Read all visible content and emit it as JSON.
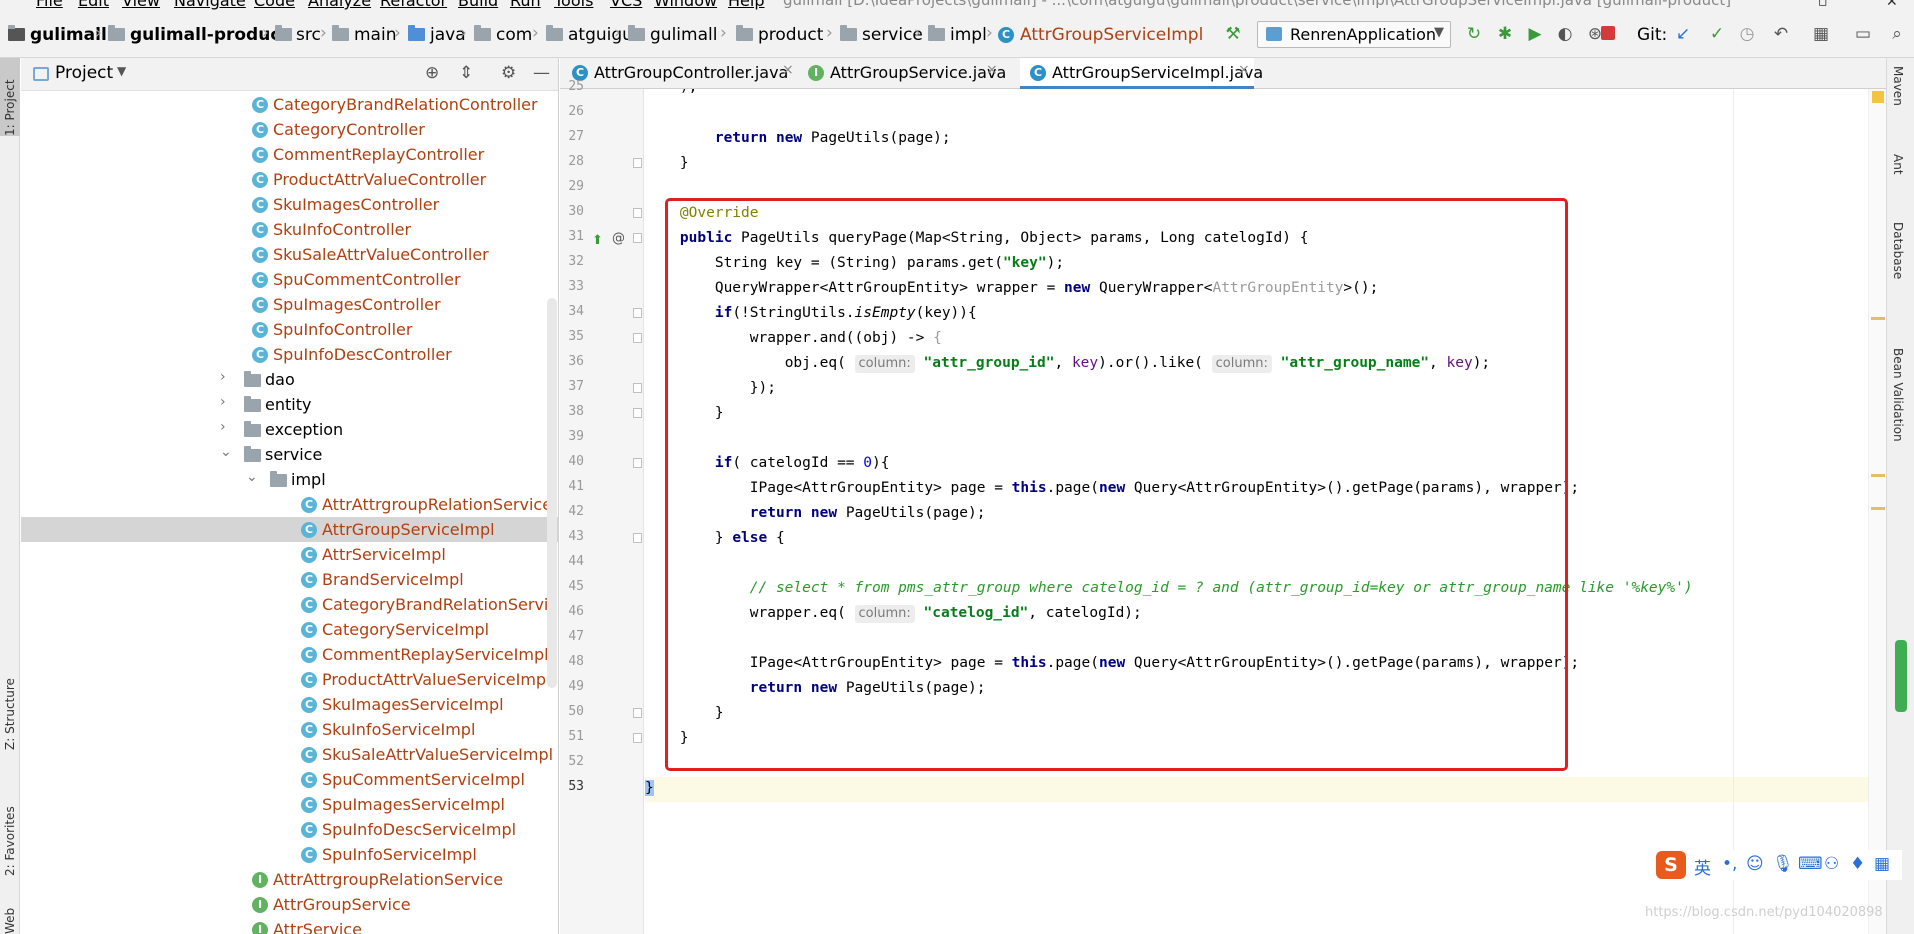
{
  "menubar": {
    "items": [
      "File",
      "Edit",
      "View",
      "Navigate",
      "Code",
      "Analyze",
      "Refactor",
      "Build",
      "Run",
      "Tools",
      "VCS",
      "Window",
      "Help"
    ],
    "window_title": "gulimall [D:\\IdeaProjects\\gulimall] - ...\\com\\atguigu\\gulimall\\product\\service\\impl\\AttrGroupServiceImpl.java [gulimall-product]"
  },
  "breadcrumb": [
    "gulimall",
    "gulimall-product",
    "src",
    "main",
    "java",
    "com",
    "atguigu",
    "gulimall",
    "product",
    "service",
    "impl",
    "AttrGroupServiceImpl"
  ],
  "toolbar": {
    "run_config": "RenrenApplication",
    "git_label": "Git:"
  },
  "left_strip": {
    "project_tab": "1: Project",
    "structure_tab": "Z: Structure",
    "favorites_tab": "2: Favorites",
    "web_tab": "Web"
  },
  "project_panel": {
    "title": "Project",
    "tree": [
      {
        "label": "CategoryBrandRelationController",
        "kind": "class"
      },
      {
        "label": "CategoryController",
        "kind": "class"
      },
      {
        "label": "CommentReplayController",
        "kind": "class"
      },
      {
        "label": "ProductAttrValueController",
        "kind": "class"
      },
      {
        "label": "SkuImagesController",
        "kind": "class"
      },
      {
        "label": "SkuInfoController",
        "kind": "class"
      },
      {
        "label": "SkuSaleAttrValueController",
        "kind": "class"
      },
      {
        "label": "SpuCommentController",
        "kind": "class"
      },
      {
        "label": "SpuImagesController",
        "kind": "class"
      },
      {
        "label": "SpuInfoController",
        "kind": "class"
      },
      {
        "label": "SpuInfoDescController",
        "kind": "class"
      },
      {
        "label": "dao",
        "kind": "package"
      },
      {
        "label": "entity",
        "kind": "package"
      },
      {
        "label": "exception",
        "kind": "package"
      },
      {
        "label": "service",
        "kind": "package"
      },
      {
        "label": "impl",
        "kind": "package"
      },
      {
        "label": "AttrAttrgroupRelationServiceIm",
        "kind": "class"
      },
      {
        "label": "AttrGroupServiceImpl",
        "kind": "class"
      },
      {
        "label": "AttrServiceImpl",
        "kind": "class"
      },
      {
        "label": "BrandServiceImpl",
        "kind": "class"
      },
      {
        "label": "CategoryBrandRelationServiceIn",
        "kind": "class"
      },
      {
        "label": "CategoryServiceImpl",
        "kind": "class"
      },
      {
        "label": "CommentReplayServiceImpl",
        "kind": "class"
      },
      {
        "label": "ProductAttrValueServiceImpl",
        "kind": "class"
      },
      {
        "label": "SkuImagesServiceImpl",
        "kind": "class"
      },
      {
        "label": "SkuInfoServiceImpl",
        "kind": "class"
      },
      {
        "label": "SkuSaleAttrValueServiceImpl",
        "kind": "class"
      },
      {
        "label": "SpuCommentServiceImpl",
        "kind": "class"
      },
      {
        "label": "SpuImagesServiceImpl",
        "kind": "class"
      },
      {
        "label": "SpuInfoDescServiceImpl",
        "kind": "class"
      },
      {
        "label": "SpuInfoServiceImpl",
        "kind": "class"
      },
      {
        "label": "AttrAttrgroupRelationService",
        "kind": "interface"
      },
      {
        "label": "AttrGroupService",
        "kind": "interface"
      },
      {
        "label": "AttrService",
        "kind": "interface"
      }
    ],
    "selected": "AttrGroupServiceImpl"
  },
  "editor": {
    "tabs": [
      {
        "label": "AttrGroupController.java",
        "kind": "class"
      },
      {
        "label": "AttrGroupService.java",
        "kind": "interface"
      },
      {
        "label": "AttrGroupServiceImpl.java",
        "kind": "class",
        "active": true
      }
    ],
    "line_numbers": [
      "25",
      "26",
      "27",
      "28",
      "29",
      "30",
      "31",
      "32",
      "33",
      "34",
      "35",
      "36",
      "37",
      "38",
      "39",
      "40",
      "41",
      "42",
      "43",
      "44",
      "45",
      "46",
      "47",
      "48",
      "49",
      "50",
      "51",
      "52",
      "53"
    ],
    "current_line": "53",
    "lines": {
      "l25": "    );",
      "l27_return": "return",
      "l27_new": "new",
      "l27_rest": " PageUtils(page);",
      "l28": "}",
      "l30": "@Override",
      "l31_public": "public",
      "l31_rest": " PageUtils queryPage(Map<String, Object> params, Long catelogId) {",
      "l32_a": "String key = (String) params.get(",
      "l32_str": "\"key\"",
      "l32_b": ");",
      "l33_a": "QueryWrapper<AttrGroupEntity> wrapper = ",
      "l33_new": "new",
      "l33_b": " QueryWrapper<",
      "l33_gray": "AttrGroupEntity",
      "l33_c": ">();",
      "l34_if": "if",
      "l34_a": "(!StringUtils.",
      "l34_italic": "isEmpty",
      "l34_b": "(key)){",
      "l35_a": "wrapper.and((obj) -> ",
      "l35_brace": "{",
      "l36_a": "obj.eq( ",
      "l36_hint1": "column:",
      "l36_str1": "\"attr_group_id\"",
      "l36_b": ", ",
      "l36_key1": "key",
      "l36_c": ").or().like( ",
      "l36_hint2": "column:",
      "l36_str2": "\"attr_group_name\"",
      "l36_d": ", ",
      "l36_key2": "key",
      "l36_e": ");",
      "l37": "});",
      "l38": "}",
      "l40_if": "if",
      "l40_a": "( catelogId == ",
      "l40_num": "0",
      "l40_b": "){",
      "l41_a": "IPage<AttrGroupEntity> page = ",
      "l41_this": "this",
      "l41_b": ".page(",
      "l41_new": "new",
      "l41_c": " Query<AttrGroupEntity>().getPage(params), wrapper);",
      "l42_return": "return",
      "l42_new": "new",
      "l42_rest": " PageUtils(page);",
      "l43_a": "} ",
      "l43_else": "else",
      "l43_b": " {",
      "l45_comment": "// select * from pms_attr_group where catelog_id = ? and (attr_group_id=key or attr_group_name like '%key%')",
      "l46_a": "wrapper.eq( ",
      "l46_hint": "column:",
      "l46_str": "\"catelog_id\"",
      "l46_b": ", catelogId);",
      "l48_a": "IPage<AttrGroupEntity> page = ",
      "l48_this": "this",
      "l48_b": ".page(",
      "l48_new": "new",
      "l48_c": " Query<AttrGroupEntity>().getPage(params), wrapper);",
      "l49_return": "return",
      "l49_new": "new",
      "l49_rest": " PageUtils(page);",
      "l50": "}",
      "l51": "}",
      "l53": "}"
    }
  },
  "right_strip": {
    "maven": "Maven",
    "ant": "Ant",
    "database": "Database",
    "bean_validation": "Bean Validation"
  },
  "ime": {
    "logo": "S",
    "lang": "英"
  },
  "watermark": "https://blog.csdn.net/pyd104020898",
  "colors": {
    "highlight_box": "#e02020",
    "keyword": "#000080",
    "string": "#067d17",
    "comment": "#2a9b2a",
    "class_label": "#b04010",
    "tab_underline": "#4083c9"
  }
}
